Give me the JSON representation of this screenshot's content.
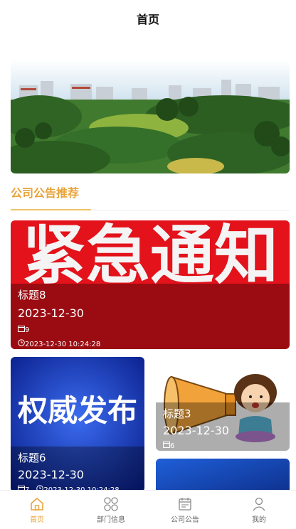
{
  "header": {
    "title": "首页"
  },
  "section": {
    "title": "公司公告推荐"
  },
  "cards": [
    {
      "title": "标题8",
      "date": "2023-12-30",
      "views": "9",
      "time": "2023-12-30 10:24:28",
      "image_text": "紧急通知"
    },
    {
      "title": "标题6",
      "date": "2023-12-30",
      "views": "7",
      "time": "2023-12-30 10:24:28",
      "image_text": "权威发布"
    },
    {
      "title": "标题3",
      "date": "2023-12-30",
      "views": "6"
    }
  ],
  "tabbar": {
    "items": [
      {
        "label": "首页",
        "icon": "home-icon",
        "active": true
      },
      {
        "label": "部门信息",
        "icon": "grid-icon"
      },
      {
        "label": "公司公告",
        "icon": "calendar-icon"
      },
      {
        "label": "我的",
        "icon": "user-icon"
      }
    ]
  },
  "colors": {
    "accent": "#e8a33a",
    "card_red": "#e3121b",
    "card_blue": "#1f3fc0"
  }
}
